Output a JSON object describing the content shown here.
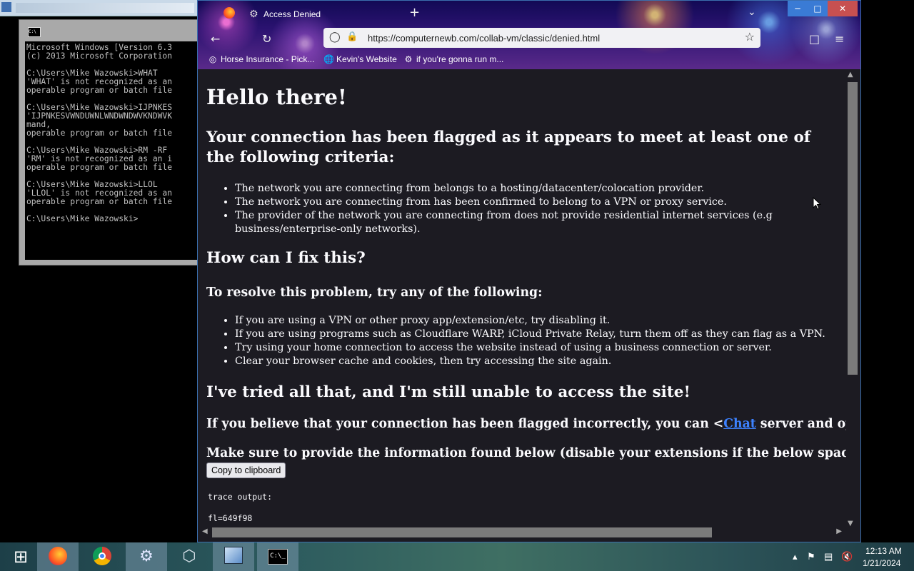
{
  "cmd": {
    "lines": "Microsoft Windows [Version 6.3\n(c) 2013 Microsoft Corporation\n\nC:\\Users\\Mike Wazowski>WHAT\n'WHAT' is not recognized as an\noperable program or batch file\n\nC:\\Users\\Mike Wazowski>IJPNKES\n'IJPNKESVWNDUWNLWNDWNDWVKNDWVK\nmand,\noperable program or batch file\n\nC:\\Users\\Mike Wazowski>RM -RF\n'RM' is not recognized as an i\noperable program or batch file\n\nC:\\Users\\Mike Wazowski>LLOL\n'LLOL' is not recognized as an\noperable program or batch file\n\nC:\\Users\\Mike Wazowski>"
  },
  "browser": {
    "tab_title": "Access Denied",
    "url": "https://computernewb.com/collab-vm/classic/denied.html",
    "bookmarks": [
      {
        "label": "Horse Insurance - Pick..."
      },
      {
        "label": "Kevin's Website"
      },
      {
        "label": "if you're gonna run m..."
      }
    ]
  },
  "page": {
    "hello": "Hello there!",
    "flagged_heading": "Your connection has been flagged as it appears to meet at least one of the following criteria:",
    "criteria": [
      "The network you are connecting from belongs to a hosting/datacenter/colocation provider.",
      "The network you are connecting from has been confirmed to belong to a VPN or proxy service.",
      "The provider of the network you are connecting from does not provide residential internet services (e.g business/enterprise-only networks)."
    ],
    "fix_heading": "How can I fix this?",
    "resolve_heading": "To resolve this problem, try any of the following:",
    "fixes": [
      "If you are using a VPN or other proxy app/extension/etc, try disabling it.",
      "If you are using programs such as Cloudflare WARP, iCloud Private Relay, turn them off as they can flag as a VPN.",
      "Try using your home connection to access the website instead of using a business connection or server.",
      "Clear your browser cache and cookies, then try accessing the site again."
    ],
    "tried_heading": "I've tried all that, and I'm still unable to access the site!",
    "flag_text_before": "If you believe that your connection has been flagged incorrectly, you can <",
    "chat_link": "Chat",
    "flag_text_after": " server and open a ticket.",
    "make_sure": "Make sure to provide the information found below (disable your extensions if the below space is empty):",
    "copy_button": "Copy to clipboard",
    "trace": "trace output:\n\nfl=649f98"
  },
  "taskbar": {
    "time": "12:13 AM",
    "date": "1/21/2024"
  },
  "icons": {
    "cmd_icon_text": "C:\\",
    "terminal_glyph": "C:\\_"
  }
}
